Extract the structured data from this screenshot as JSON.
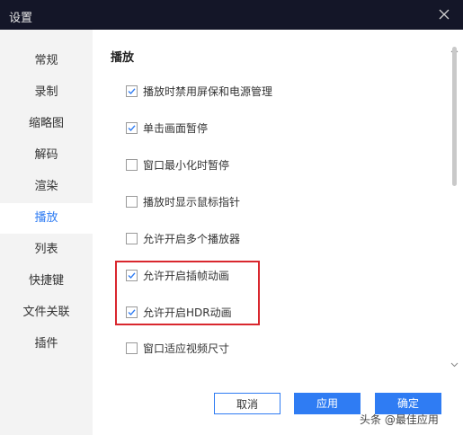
{
  "window": {
    "title": "设置"
  },
  "sidebar": {
    "items": [
      {
        "label": "常规"
      },
      {
        "label": "录制"
      },
      {
        "label": "缩略图"
      },
      {
        "label": "解码"
      },
      {
        "label": "渲染"
      },
      {
        "label": "播放",
        "active": true
      },
      {
        "label": "列表"
      },
      {
        "label": "快捷键"
      },
      {
        "label": "文件关联"
      },
      {
        "label": "插件"
      }
    ]
  },
  "section": {
    "title": "播放"
  },
  "options": [
    {
      "label": "播放时禁用屏保和电源管理",
      "checked": true
    },
    {
      "label": "单击画面暂停",
      "checked": true
    },
    {
      "label": "窗口最小化时暂停",
      "checked": false
    },
    {
      "label": "播放时显示鼠标指针",
      "checked": false
    },
    {
      "label": "允许开启多个播放器",
      "checked": false
    },
    {
      "label": "允许开启插帧动画",
      "checked": true
    },
    {
      "label": "允许开启HDR动画",
      "checked": true
    },
    {
      "label": "窗口适应视频尺寸",
      "checked": false
    }
  ],
  "buttons": {
    "cancel": "取消",
    "apply": "应用",
    "ok": "确定"
  },
  "watermark": "头条 @最佳应用",
  "icons": {
    "close": "close-icon",
    "check": "checkmark-icon"
  },
  "colors": {
    "accent": "#2f7cf3",
    "titlebar": "#141628",
    "highlight": "#d9272e"
  }
}
